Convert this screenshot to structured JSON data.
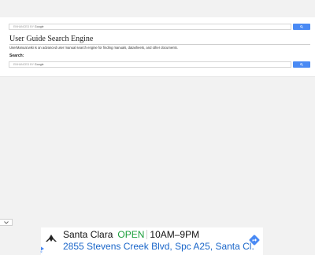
{
  "top_search": {
    "placeholder_prefix": "ENHANCED BY",
    "placeholder_brand": "Google",
    "button_icon": "search-icon"
  },
  "page": {
    "title": "User Guide Search Engine",
    "description": "UserManual.wiki is an advanced user manual search engine for finding manuals, datasheets, and other documents.",
    "search_label": "Search:"
  },
  "main_search": {
    "placeholder_prefix": "ENHANCED BY",
    "placeholder_brand": "Google",
    "button_icon": "search-icon"
  },
  "collapse_tab": {
    "icon": "chevron-down-icon"
  },
  "ad": {
    "city": "Santa Clara",
    "status": "OPEN",
    "hours": "10AM–9PM",
    "address": "2855 Stevens Creek Blvd, Spc A25, Santa Cl.",
    "logo_icon": "brand-logo-icon",
    "directions_icon": "directions-icon",
    "adchoices_icon": "adchoices-icon",
    "close_icon": "close-icon",
    "colors": {
      "open": "#1a9e3a",
      "address": "#1a66c9",
      "directions": "#4a8af4"
    }
  },
  "colors": {
    "search_button": "#4a8af4",
    "background": "#f2f2f2"
  }
}
